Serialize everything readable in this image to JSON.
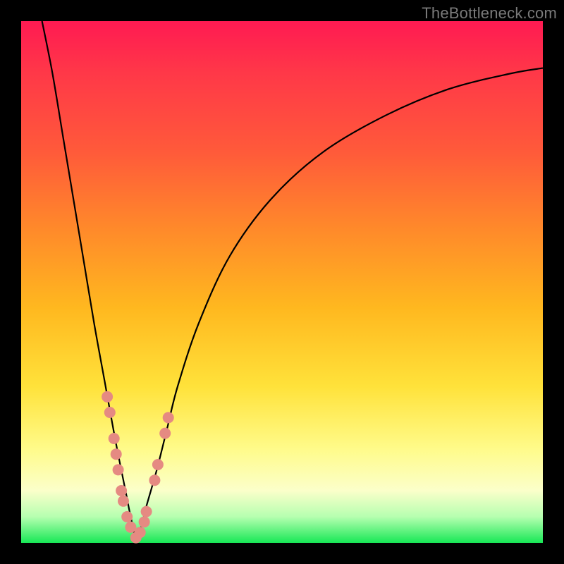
{
  "watermark": "TheBottleneck.com",
  "colors": {
    "frame_bg": "#000000",
    "gradient_top": "#ff1a52",
    "gradient_mid1": "#ff8a2a",
    "gradient_mid2": "#ffe23a",
    "gradient_low": "#fbffca",
    "gradient_bottom": "#18e856",
    "curve": "#000000",
    "bead": "#e58a82",
    "watermark_text": "#7a7a7a"
  },
  "chart_data": {
    "type": "line",
    "title": "",
    "xlabel": "",
    "ylabel": "",
    "x_range": [
      0,
      100
    ],
    "y_range": [
      0,
      100
    ],
    "note": "Bottleneck / mismatch curve. x is relative component ratio (percent), y is bottleneck percentage. Minimum (~0%) near x≈22. Values read off the plotted curve; no axis ticks are shown so values are estimated from pixel position.",
    "series": [
      {
        "name": "bottleneck_curve",
        "x": [
          4,
          6,
          8,
          10,
          12,
          14,
          16,
          18,
          20,
          21,
          22,
          23,
          24,
          26,
          28,
          30,
          34,
          40,
          48,
          58,
          70,
          82,
          94,
          100
        ],
        "y": [
          100,
          90,
          78,
          66,
          54,
          42,
          31,
          20,
          10,
          5,
          1,
          3,
          7,
          14,
          22,
          30,
          42,
          55,
          66,
          75,
          82,
          87,
          90,
          91
        ]
      }
    ],
    "markers": {
      "name": "highlighted_points",
      "description": "Salmon bead markers clustered near the curve minimum on both branches.",
      "points": [
        {
          "x": 16.5,
          "y": 28
        },
        {
          "x": 17.0,
          "y": 25
        },
        {
          "x": 17.8,
          "y": 20
        },
        {
          "x": 18.2,
          "y": 17
        },
        {
          "x": 18.6,
          "y": 14
        },
        {
          "x": 19.2,
          "y": 10
        },
        {
          "x": 19.6,
          "y": 8
        },
        {
          "x": 20.3,
          "y": 5
        },
        {
          "x": 21.0,
          "y": 3
        },
        {
          "x": 22.0,
          "y": 1
        },
        {
          "x": 22.8,
          "y": 2
        },
        {
          "x": 23.6,
          "y": 4
        },
        {
          "x": 24.0,
          "y": 6
        },
        {
          "x": 25.6,
          "y": 12
        },
        {
          "x": 26.2,
          "y": 15
        },
        {
          "x": 27.6,
          "y": 21
        },
        {
          "x": 28.2,
          "y": 24
        }
      ]
    }
  }
}
